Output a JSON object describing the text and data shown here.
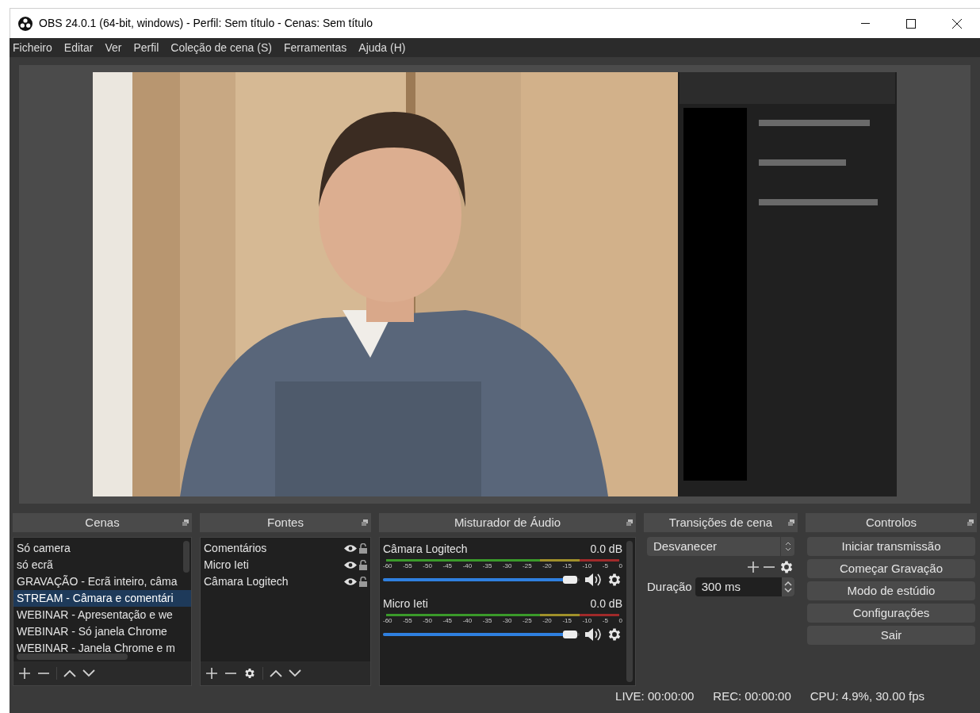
{
  "window": {
    "title": "OBS 24.0.1 (64-bit, windows) - Perfil: Sem título - Cenas: Sem título"
  },
  "menu": [
    "Ficheiro",
    "Editar",
    "Ver",
    "Perfil",
    "Coleção de cena (S)",
    "Ferramentas",
    "Ajuda (H)"
  ],
  "scenes": {
    "title": "Cenas",
    "items": [
      {
        "label": "Só camera",
        "selected": false
      },
      {
        "label": "só ecrã",
        "selected": false
      },
      {
        "label": "GRAVAÇÃO - Ecrã inteiro, câma",
        "selected": false
      },
      {
        "label": "STREAM - Câmara e comentári",
        "selected": true
      },
      {
        "label": "WEBINAR - Apresentação e we",
        "selected": false
      },
      {
        "label": "WEBINAR - Só janela Chrome",
        "selected": false
      },
      {
        "label": "WEBINAR - Janela Chrome e m",
        "selected": false
      }
    ]
  },
  "sources": {
    "title": "Fontes",
    "items": [
      {
        "label": "Comentários",
        "visible": true,
        "locked": false
      },
      {
        "label": "Micro Ieti",
        "visible": true,
        "locked": false
      },
      {
        "label": "Câmara Logitech",
        "visible": true,
        "locked": false
      }
    ]
  },
  "mixer": {
    "title": "Misturador de Áudio",
    "channels": [
      {
        "name": "Câmara Logitech",
        "reading": "0.0 dB",
        "level": 0.95,
        "muted": false,
        "scale": [
          "-60",
          "-55",
          "-50",
          "-45",
          "-40",
          "-35",
          "-30",
          "-25",
          "-20",
          "-15",
          "-10",
          "-5",
          "0"
        ]
      },
      {
        "name": "Micro Ieti",
        "reading": "0.0 dB",
        "level": 0.95,
        "muted": false,
        "scale": [
          "-60",
          "-55",
          "-50",
          "-45",
          "-40",
          "-35",
          "-30",
          "-25",
          "-20",
          "-15",
          "-10",
          "-5",
          "0"
        ]
      }
    ]
  },
  "transitions": {
    "title": "Transições de cena",
    "selected": "Desvanecer",
    "duration_label": "Duração",
    "duration": "300 ms"
  },
  "controls": {
    "title": "Controlos",
    "buttons": [
      "Iniciar transmissão",
      "Começar Gravação",
      "Modo de estúdio",
      "Configurações",
      "Sair"
    ]
  },
  "status_bar": {
    "live": "LIVE: 00:00:00",
    "rec": "REC: 00:00:00",
    "cpu": "CPU: 4.9%, 30.00 fps"
  }
}
